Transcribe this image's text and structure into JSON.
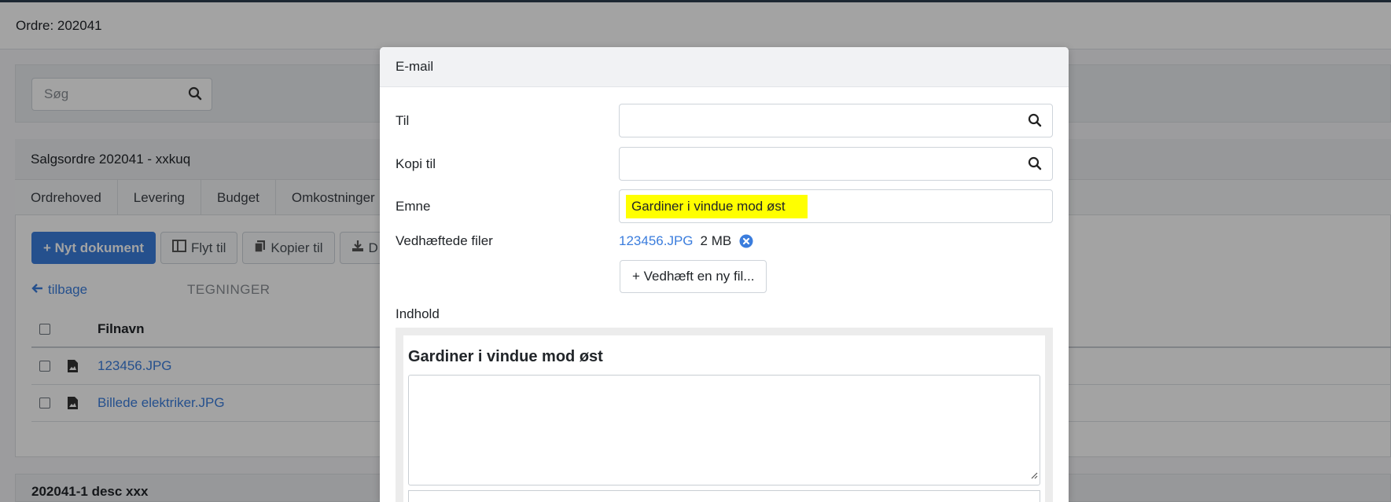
{
  "page": {
    "title": "Ordre: 202041",
    "search_placeholder": "Søg",
    "order_card_title": "Salgsordre 202041 - xxkuq",
    "tabs": [
      "Ordrehoved",
      "Levering",
      "Budget",
      "Omkostninger"
    ],
    "toolbar": {
      "new_document": "+ Nyt dokument",
      "move_to": "Flyt til",
      "copy_to": "Kopier til",
      "download_partial": "D"
    },
    "back_label": "tilbage",
    "section_label": "TEGNINGER",
    "file_header": "Filnavn",
    "files": [
      "123456.JPG",
      "Billede elektriker.JPG"
    ],
    "desc_card_title": "202041-1 desc xxx"
  },
  "modal": {
    "title": "E-mail",
    "to_label": "Til",
    "to_value": "",
    "cc_label": "Kopi til",
    "cc_value": "",
    "subject_label": "Emne",
    "subject_value": "Gardiner i vindue mod øst",
    "attachments_label": "Vedhæftede filer",
    "attachment_name": "123456.JPG",
    "attachment_size": "2 MB",
    "attach_button": "+ Vedhæft en ny fil...",
    "content_label": "Indhold",
    "editor_title": "Gardiner i vindue mod øst"
  },
  "colors": {
    "accent": "#3b7ddd",
    "highlight": "#ffff00",
    "overlay": "rgba(0,0,0,0.36)"
  },
  "icons": {
    "search": "search-icon",
    "remove": "remove-circle-icon",
    "file_image": "file-image-icon",
    "arrow_left": "arrow-left-icon"
  }
}
